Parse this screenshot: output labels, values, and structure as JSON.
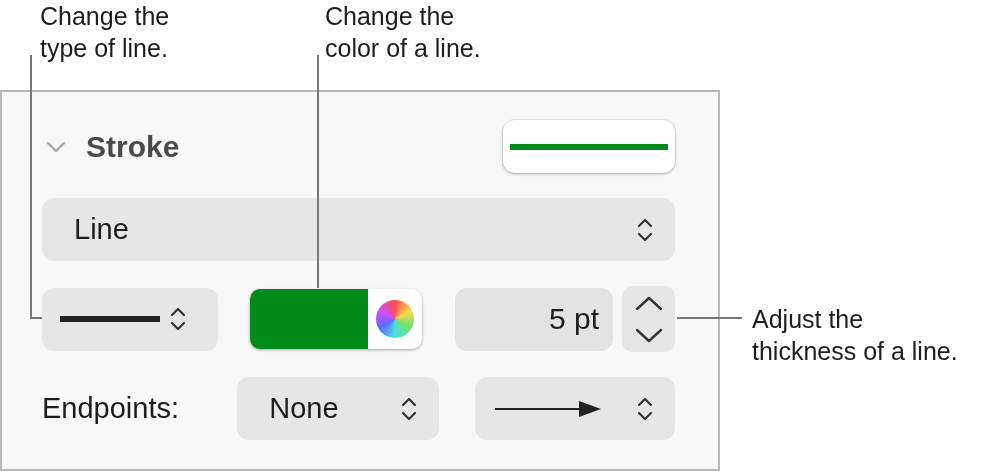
{
  "callouts": [
    {
      "kind": "top-left",
      "lines": [
        "Change the",
        "type of line."
      ]
    },
    {
      "kind": "top-middle",
      "lines": [
        "Change the",
        "color of a line."
      ]
    },
    {
      "kind": "right",
      "lines": [
        "Adjust the",
        "thickness of a line."
      ]
    }
  ],
  "panel": {
    "section": {
      "title": "Stroke",
      "expanded": true
    },
    "stroke": {
      "color": "#038b1c"
    },
    "stroke_type": "Line",
    "thickness": "5 pt",
    "endpoints": {
      "label": "Endpoints:",
      "start": "None"
    }
  }
}
